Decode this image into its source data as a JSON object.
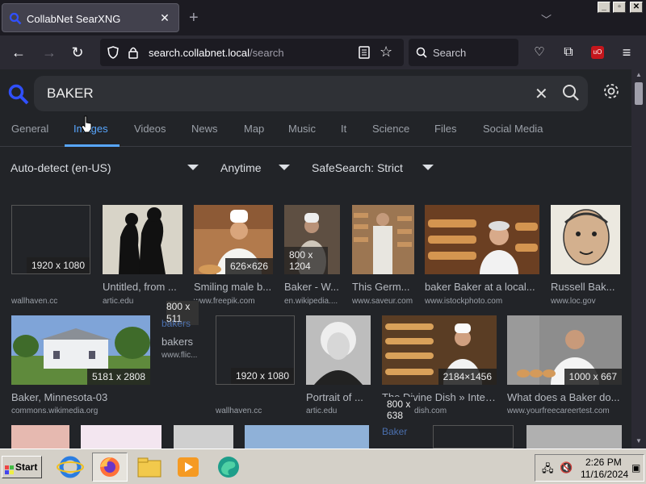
{
  "browser": {
    "tab_title": "CollabNet SearXNG",
    "url_host": "search.collabnet.local",
    "url_path": "/search",
    "search_placeholder": "Search"
  },
  "search": {
    "query": "BAKER",
    "categories": [
      "General",
      "Images",
      "Videos",
      "News",
      "Map",
      "Music",
      "It",
      "Science",
      "Files",
      "Social Media"
    ],
    "active_category": "Images",
    "filters": {
      "language": "Auto-detect (en-US)",
      "time": "Anytime",
      "safesearch": "SafeSearch: Strict"
    }
  },
  "results": [
    {
      "res": "1920 x 1080",
      "title": "",
      "url": "wallhaven.cc"
    },
    {
      "res": "",
      "title": "Untitled, from ...",
      "url": "artic.edu"
    },
    {
      "res": "626×626",
      "title": "Smiling male b...",
      "url": "www.freepik.com"
    },
    {
      "res": "800 x 1204",
      "title": "Baker - W...",
      "url": "en.wikipedia...."
    },
    {
      "res": "",
      "title": "This Germ...",
      "url": "www.saveur.com"
    },
    {
      "res": "",
      "title": "baker Baker at a local...",
      "url": "www.istockphoto.com"
    },
    {
      "res": "",
      "title": "Russell Bak...",
      "url": "www.loc.gov"
    },
    {
      "res": "5181 x 2808",
      "title": "Baker, Minnesota-03",
      "url": "commons.wikimedia.org"
    },
    {
      "res": "800 x 511",
      "title": "bakers",
      "url": "www.flic..."
    },
    {
      "res": "1920 x 1080",
      "title": "",
      "url": "wallhaven.cc"
    },
    {
      "res": "",
      "title": "Portrait of ...",
      "url": "artic.edu"
    },
    {
      "res": "2184×1456",
      "title": "The Divine Dish » Inter...",
      "url": "thedivinedish.com"
    },
    {
      "res": "1000 x 667",
      "title": "What does a Baker do...",
      "url": "www.yourfreecareertest.com"
    },
    {
      "res": "800 x 638",
      "title": "",
      "url": ""
    }
  ],
  "overlay_labels": {
    "bakers_alt": "bakers",
    "baker_alt": "Baker"
  },
  "taskbar": {
    "start": "Start",
    "time": "2:26 PM",
    "date": "11/16/2024"
  },
  "colors": {
    "page_bg": "#222428",
    "accent": "#58a6ff",
    "toolbar": "#2b2a33"
  }
}
